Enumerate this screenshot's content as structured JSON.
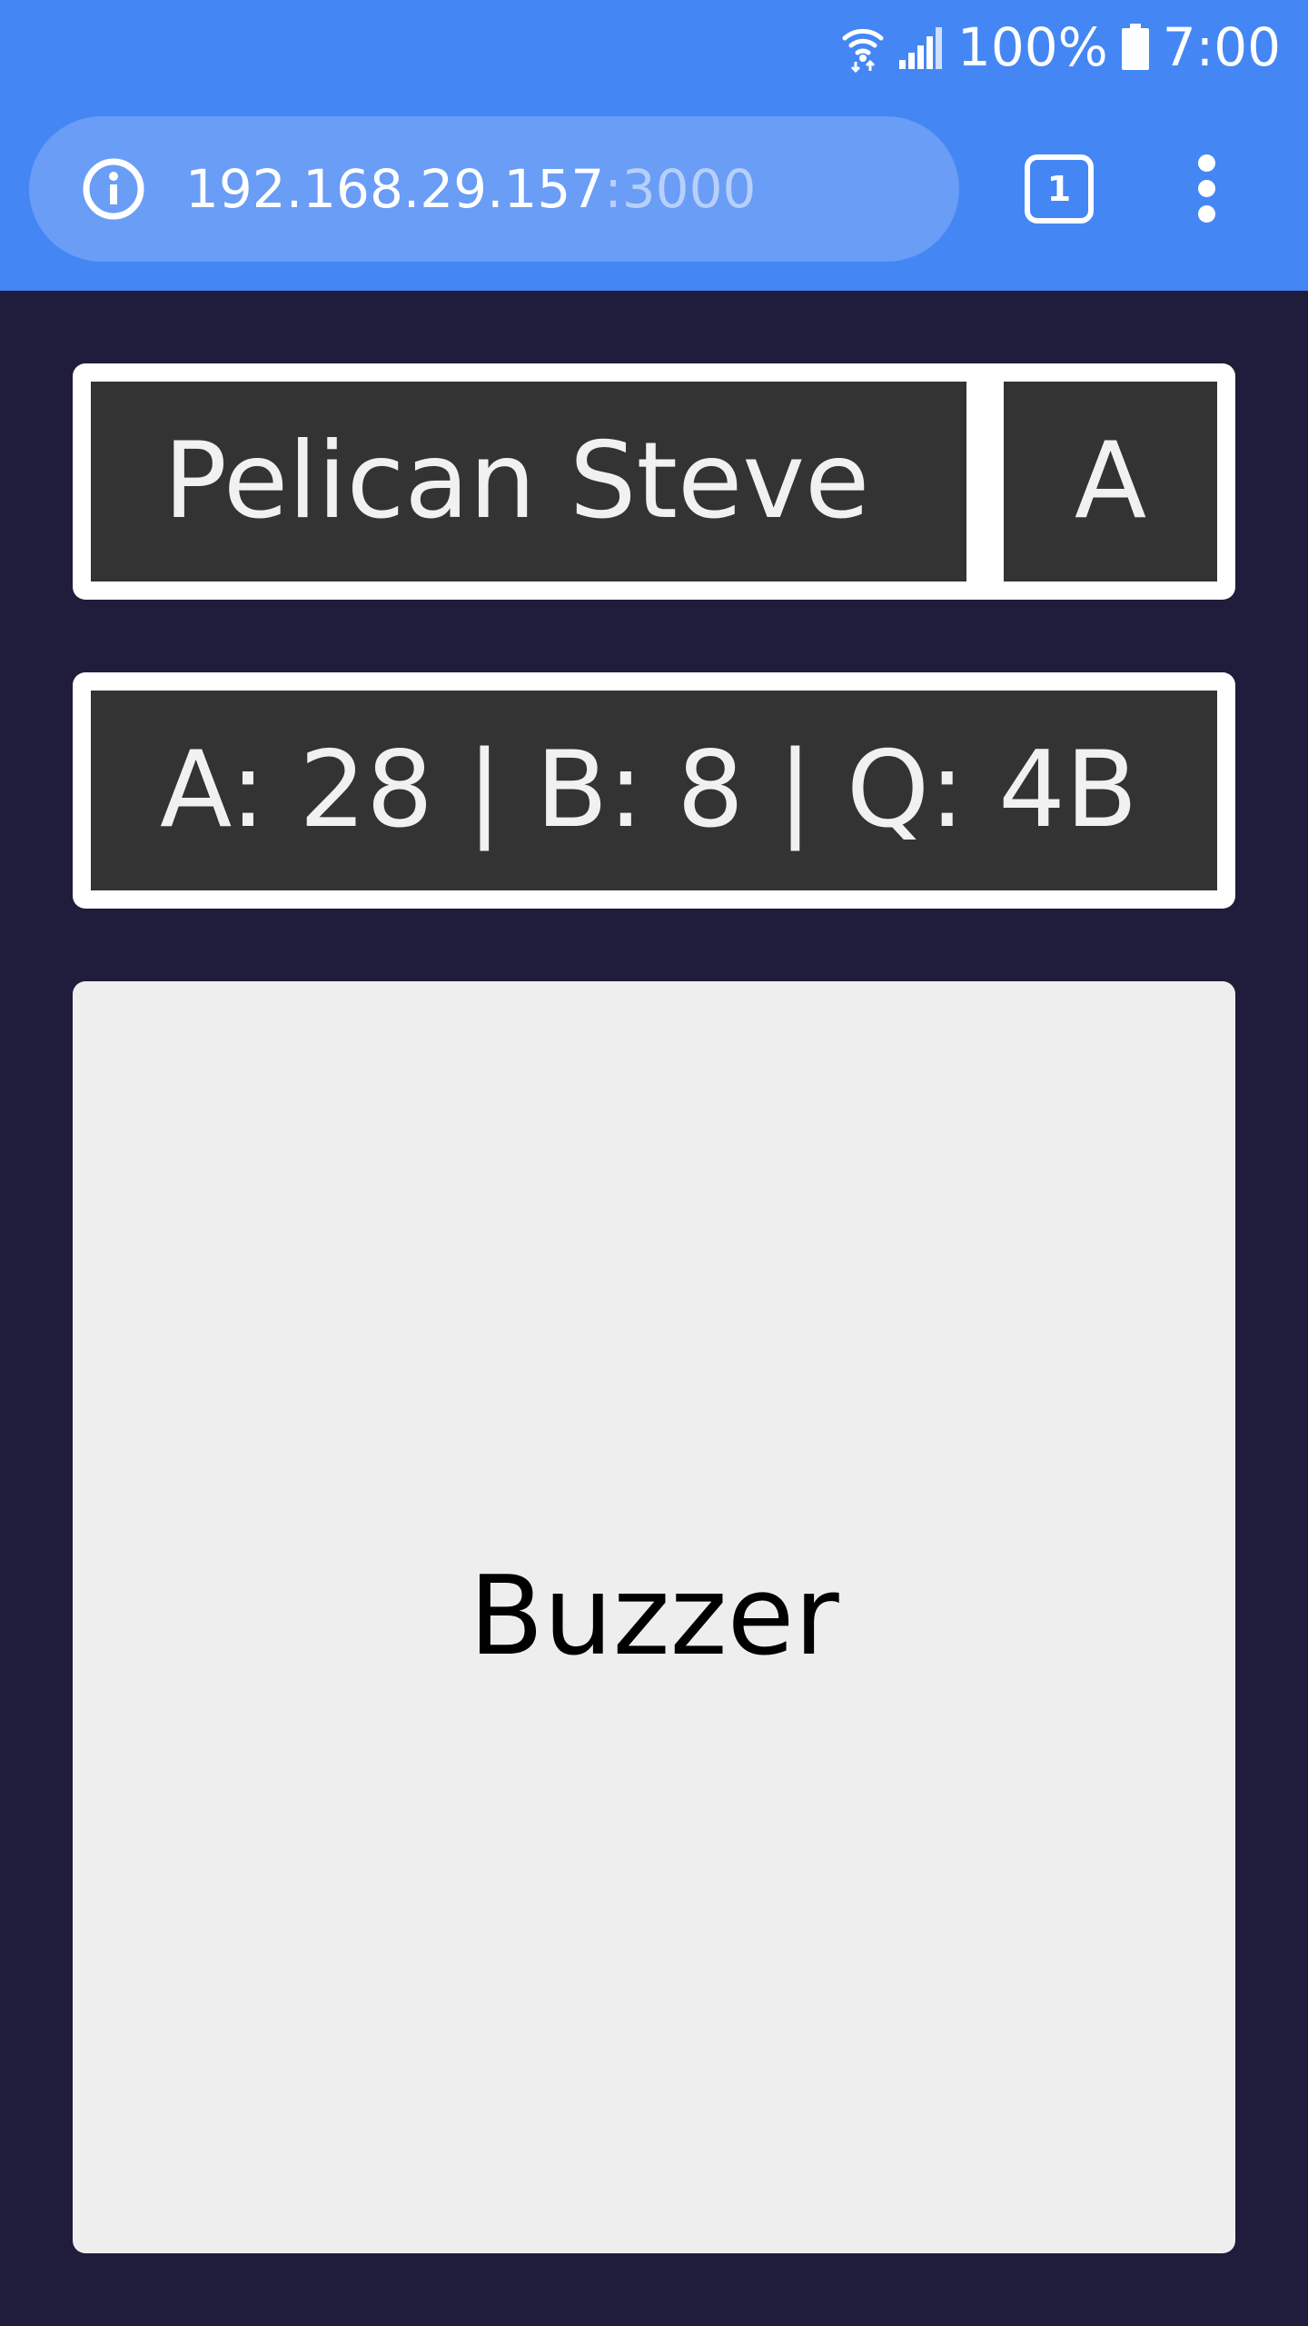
{
  "status_bar": {
    "battery_percent": "100%",
    "time": "7:00",
    "icons": [
      "wifi-icon",
      "signal-icon",
      "battery-icon"
    ]
  },
  "browser": {
    "url_host": "192.168.29.157",
    "url_port": ":3000",
    "tab_count": "1",
    "colors": {
      "toolbar": "#4487f4",
      "url_pill": "#699df6"
    }
  },
  "player": {
    "name": "Pelican Steve",
    "team": "A"
  },
  "scoreboard": {
    "text": "A: 28 | B: 8 | Q: 4B"
  },
  "buzzer": {
    "label": "Buzzer"
  },
  "colors": {
    "page_background": "#201c3b",
    "cell_background": "#333333",
    "buzzer_background": "#eeeeef"
  }
}
